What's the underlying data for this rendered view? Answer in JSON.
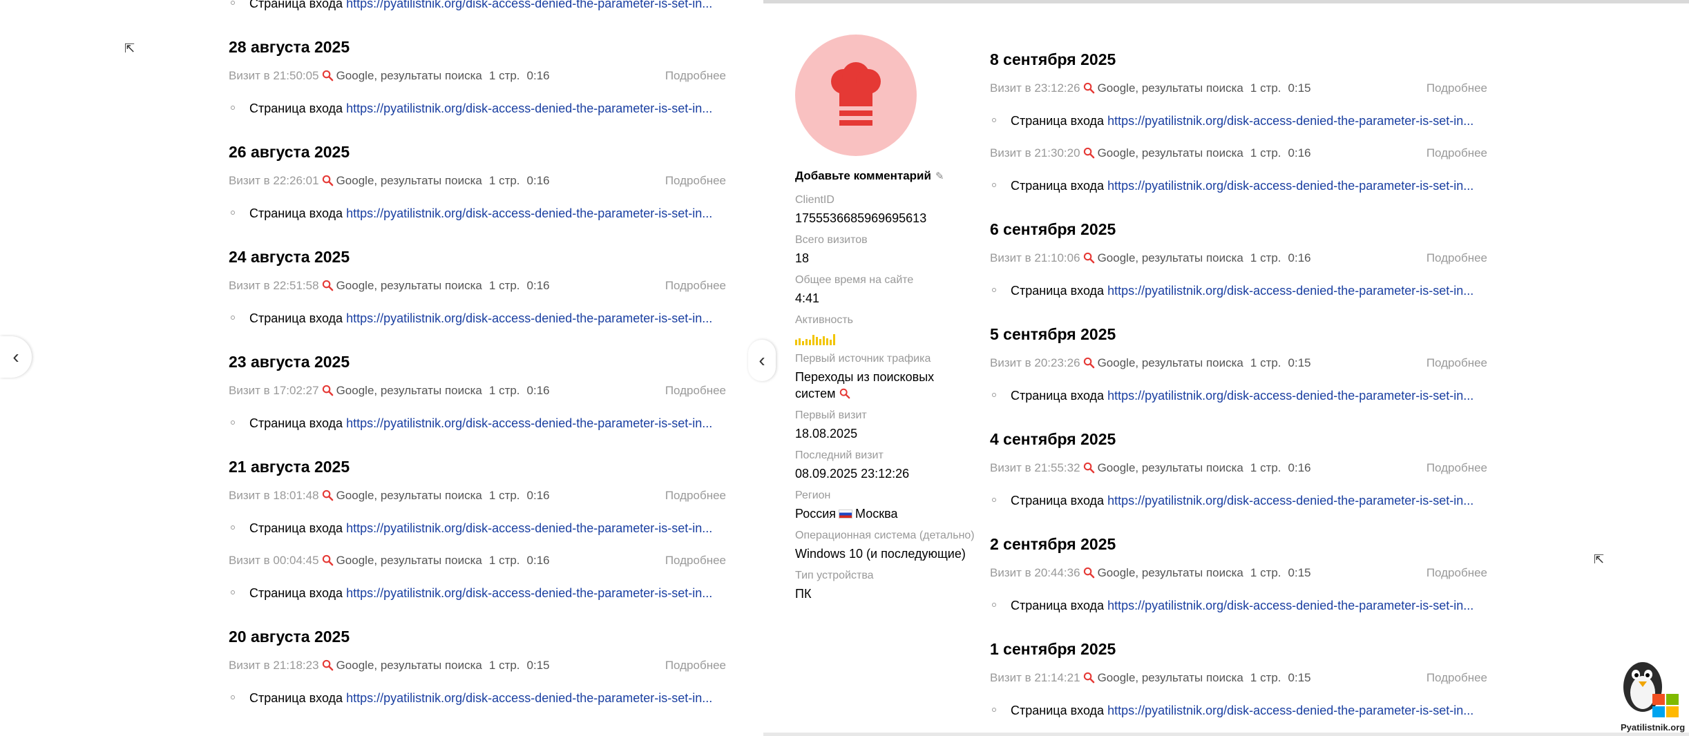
{
  "colors": {
    "link": "#1a3fa1",
    "muted": "#999999",
    "avatar_bg": "#f9c1c1",
    "accent_red": "#e53935",
    "activity": "#f2c500"
  },
  "icons": {
    "search": "search-icon",
    "pencil": "pencil-icon",
    "avatar": "chef-hat-icon",
    "nav": "chevron-left-icon",
    "flag": "russia-flag-icon"
  },
  "left_panel": {
    "top_cut_row": {
      "label": "Страница входа",
      "url": "https://pyatilistnik.org/disk-access-denied-the-parameter-is-set-in..."
    },
    "days": [
      {
        "date": "28 августа 2025",
        "visits": [
          {
            "time": "Визит в 21:50:05",
            "source": "Google, результаты поиска",
            "pages": "1 стр.",
            "duration": "0:16",
            "more": "Подробнее",
            "page_label": "Страница входа",
            "url": "https://pyatilistnik.org/disk-access-denied-the-parameter-is-set-in..."
          }
        ]
      },
      {
        "date": "26 августа 2025",
        "visits": [
          {
            "time": "Визит в 22:26:01",
            "source": "Google, результаты поиска",
            "pages": "1 стр.",
            "duration": "0:16",
            "more": "Подробнее",
            "page_label": "Страница входа",
            "url": "https://pyatilistnik.org/disk-access-denied-the-parameter-is-set-in..."
          }
        ]
      },
      {
        "date": "24 августа 2025",
        "visits": [
          {
            "time": "Визит в 22:51:58",
            "source": "Google, результаты поиска",
            "pages": "1 стр.",
            "duration": "0:16",
            "more": "Подробнее",
            "page_label": "Страница входа",
            "url": "https://pyatilistnik.org/disk-access-denied-the-parameter-is-set-in..."
          }
        ]
      },
      {
        "date": "23 августа 2025",
        "visits": [
          {
            "time": "Визит в 17:02:27",
            "source": "Google, результаты поиска",
            "pages": "1 стр.",
            "duration": "0:16",
            "more": "Подробнее",
            "page_label": "Страница входа",
            "url": "https://pyatilistnik.org/disk-access-denied-the-parameter-is-set-in..."
          }
        ]
      },
      {
        "date": "21 августа 2025",
        "visits": [
          {
            "time": "Визит в 18:01:48",
            "source": "Google, результаты поиска",
            "pages": "1 стр.",
            "duration": "0:16",
            "more": "Подробнее",
            "page_label": "Страница входа",
            "url": "https://pyatilistnik.org/disk-access-denied-the-parameter-is-set-in..."
          },
          {
            "time": "Визит в 00:04:45",
            "source": "Google, результаты поиска",
            "pages": "1 стр.",
            "duration": "0:16",
            "more": "Подробнее",
            "page_label": "Страница входа",
            "url": "https://pyatilistnik.org/disk-access-denied-the-parameter-is-set-in..."
          }
        ]
      },
      {
        "date": "20 августа 2025",
        "visits": [
          {
            "time": "Визит в 21:18:23",
            "source": "Google, результаты поиска",
            "pages": "1 стр.",
            "duration": "0:15",
            "more": "Подробнее",
            "page_label": "Страница входа",
            "url": "https://pyatilistnik.org/disk-access-denied-the-parameter-is-set-in..."
          }
        ]
      }
    ]
  },
  "profile": {
    "comment": "Добавьте комментарий",
    "fields": [
      {
        "label": "ClientID",
        "value": "1755536685969695613"
      },
      {
        "label": "Всего визитов",
        "value": "18"
      },
      {
        "label": "Общее время на сайте",
        "value": "4:41"
      },
      {
        "label": "Активность",
        "value": ""
      },
      {
        "label": "Первый источник трафика",
        "value": "Переходы из поисковых систем"
      },
      {
        "label": "Первый визит",
        "value": "18.08.2025"
      },
      {
        "label": "Последний визит",
        "value": "08.09.2025 23:12:26"
      },
      {
        "label": "Регион",
        "value_country": "Россия",
        "value_city": "Москва"
      },
      {
        "label": "Операционная система (детально)",
        "value": "Windows 10 (и последующие)"
      },
      {
        "label": "Тип устройства",
        "value": "ПК"
      }
    ],
    "activity_levels": [
      0.4,
      0.6,
      0.3,
      0.5,
      0.4,
      0.9,
      0.7,
      0.5,
      0.8,
      0.6,
      0.4,
      1.0
    ]
  },
  "right_panel": {
    "days": [
      {
        "date": "8 сентября 2025",
        "visits": [
          {
            "time": "Визит в 23:12:26",
            "source": "Google, результаты поиска",
            "pages": "1 стр.",
            "duration": "0:15",
            "more": "Подробнее",
            "page_label": "Страница входа",
            "url": "https://pyatilistnik.org/disk-access-denied-the-parameter-is-set-in..."
          },
          {
            "time": "Визит в 21:30:20",
            "source": "Google, результаты поиска",
            "pages": "1 стр.",
            "duration": "0:16",
            "more": "Подробнее",
            "page_label": "Страница входа",
            "url": "https://pyatilistnik.org/disk-access-denied-the-parameter-is-set-in..."
          }
        ]
      },
      {
        "date": "6 сентября 2025",
        "visits": [
          {
            "time": "Визит в 21:10:06",
            "source": "Google, результаты поиска",
            "pages": "1 стр.",
            "duration": "0:16",
            "more": "Подробнее",
            "page_label": "Страница входа",
            "url": "https://pyatilistnik.org/disk-access-denied-the-parameter-is-set-in..."
          }
        ]
      },
      {
        "date": "5 сентября 2025",
        "visits": [
          {
            "time": "Визит в 20:23:26",
            "source": "Google, результаты поиска",
            "pages": "1 стр.",
            "duration": "0:15",
            "more": "Подробнее",
            "page_label": "Страница входа",
            "url": "https://pyatilistnik.org/disk-access-denied-the-parameter-is-set-in..."
          }
        ]
      },
      {
        "date": "4 сентября 2025",
        "visits": [
          {
            "time": "Визит в 21:55:32",
            "source": "Google, результаты поиска",
            "pages": "1 стр.",
            "duration": "0:16",
            "more": "Подробнее",
            "page_label": "Страница входа",
            "url": "https://pyatilistnik.org/disk-access-denied-the-parameter-is-set-in..."
          }
        ]
      },
      {
        "date": "2 сентября 2025",
        "visits": [
          {
            "time": "Визит в 20:44:36",
            "source": "Google, результаты поиска",
            "pages": "1 стр.",
            "duration": "0:15",
            "more": "Подробнее",
            "page_label": "Страница входа",
            "url": "https://pyatilistnik.org/disk-access-denied-the-parameter-is-set-in..."
          }
        ]
      },
      {
        "date": "1 сентября 2025",
        "visits": [
          {
            "time": "Визит в 21:14:21",
            "source": "Google, результаты поиска",
            "pages": "1 стр.",
            "duration": "0:15",
            "more": "Подробнее",
            "page_label": "Страница входа",
            "url": "https://pyatilistnik.org/disk-access-denied-the-parameter-is-set-in..."
          }
        ]
      }
    ]
  },
  "watermark": {
    "text": "Pyatilistnik.org"
  }
}
